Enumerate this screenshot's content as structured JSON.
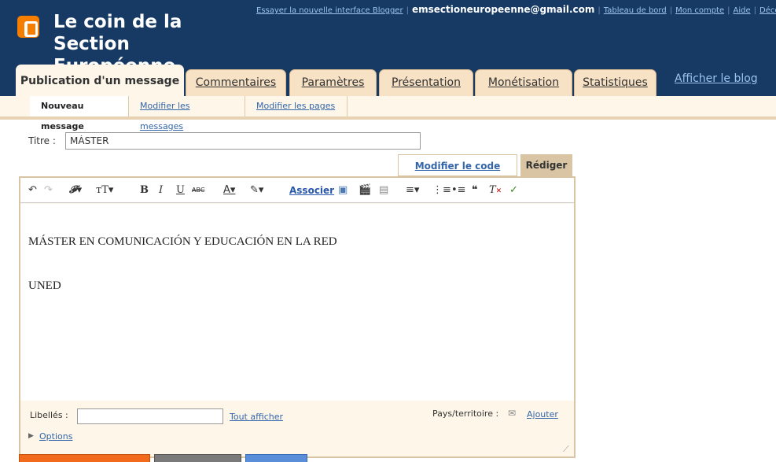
{
  "header": {
    "blog_title": "Le coin de la Section Européenne",
    "nav": {
      "try_new": "Essayer la nouvelle interface Blogger",
      "email": "emsectioneuropeenne@gmail.com",
      "dashboard": "Tableau de bord",
      "account": "Mon compte",
      "help": "Aide",
      "logout": "Décon"
    }
  },
  "tabs": [
    {
      "label": "Publication d'un message",
      "active": true
    },
    {
      "label": "Commentaires"
    },
    {
      "label": "Paramètres"
    },
    {
      "label": "Présentation"
    },
    {
      "label": "Monétisation"
    },
    {
      "label": "Statistiques"
    }
  ],
  "view_blog": "Afficher le blog",
  "subtabs": [
    {
      "label": "Nouveau message",
      "active": true
    },
    {
      "label": "Modifier les messages"
    },
    {
      "label": "Modifier les pages"
    }
  ],
  "post": {
    "title_label": "Titre :",
    "title_value": "MÁSTER"
  },
  "editor": {
    "mode_html": "Modifier le code HTML",
    "mode_compose": "Rédiger",
    "link_label": "Associer",
    "body": [
      "MÁSTER EN COMUNICACIÓN Y EDUCACIÓN EN LA RED",
      "UNED"
    ],
    "labels_label": "Libellés :",
    "labels_value": "",
    "show_all": "Tout afficher",
    "country_label": "Pays/territoire :",
    "country_add": "Ajouter",
    "options": "Options"
  },
  "colors": {
    "header_bg": "#163a63",
    "accent": "#f57d00",
    "link": "#3366aa",
    "tab_bg": "#f7e2c5",
    "panel_bg": "#fdf6e9"
  }
}
